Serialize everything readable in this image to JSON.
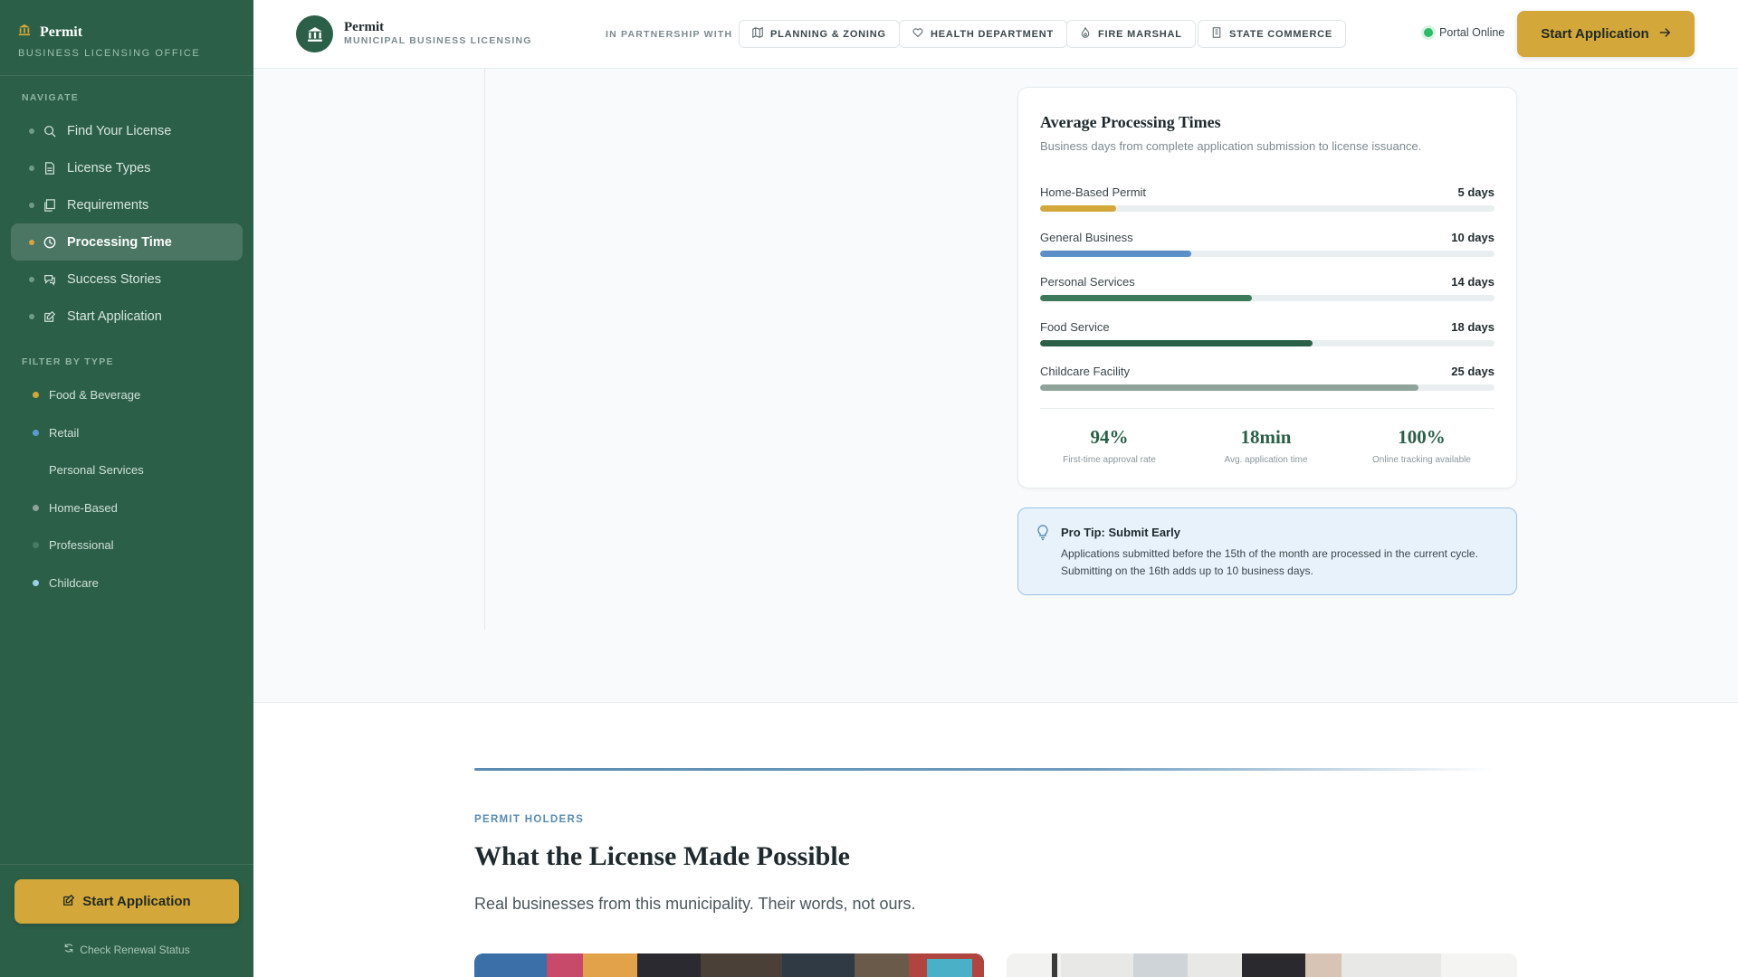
{
  "sidebar": {
    "brand_title": "Permit",
    "brand_sub": "BUSINESS LICENSING OFFICE",
    "nav_label": "NAVIGATE",
    "nav": [
      {
        "label": "Find Your License",
        "icon": "search-icon"
      },
      {
        "label": "License Types",
        "icon": "document-icon"
      },
      {
        "label": "Requirements",
        "icon": "files-icon"
      },
      {
        "label": "Processing Time",
        "icon": "clock-icon",
        "active": true
      },
      {
        "label": "Success Stories",
        "icon": "chat-icon"
      },
      {
        "label": "Start Application",
        "icon": "edit-icon"
      }
    ],
    "filter_label": "FILTER BY TYPE",
    "filters": [
      {
        "label": "Food & Beverage",
        "color": "#d4a73a"
      },
      {
        "label": "Retail",
        "color": "#5a9bd4"
      },
      {
        "label": "Personal Services",
        "color": "#2c5f48"
      },
      {
        "label": "Home-Based",
        "color": "#8fa39a"
      },
      {
        "label": "Professional",
        "color": "#4a7a62"
      },
      {
        "label": "Childcare",
        "color": "#9ad0e8"
      }
    ],
    "cta_label": "Start Application",
    "renew_label": "Check Renewal Status"
  },
  "header": {
    "title": "Permit",
    "subtitle": "MUNICIPAL BUSINESS LICENSING",
    "partner_label": "IN PARTNERSHIP WITH",
    "partners": [
      {
        "label": "PLANNING & ZONING",
        "icon": "map-icon"
      },
      {
        "label": "HEALTH DEPARTMENT",
        "icon": "heart-icon"
      },
      {
        "label": "FIRE MARSHAL",
        "icon": "flame-icon"
      },
      {
        "label": "STATE COMMERCE",
        "icon": "building-icon"
      }
    ],
    "status": "Portal Online",
    "cta_label": "Start Application"
  },
  "processing": {
    "title": "Average Processing Times",
    "description": "Business days from complete application submission to license issuance.",
    "bars": [
      {
        "label": "Home-Based Permit",
        "value": "5 days",
        "days": 5,
        "color": "#d4a73a"
      },
      {
        "label": "General Business",
        "value": "10 days",
        "days": 10,
        "color": "#5a8fc8"
      },
      {
        "label": "Personal Services",
        "value": "14 days",
        "days": 14,
        "color": "#3d7a5c"
      },
      {
        "label": "Food Service",
        "value": "18 days",
        "days": 18,
        "color": "#2c5f48"
      },
      {
        "label": "Childcare Facility",
        "value": "25 days",
        "days": 25,
        "color": "#8fa39a"
      }
    ],
    "max_days": 30,
    "stats": [
      {
        "value": "94%",
        "label": "First-time approval rate"
      },
      {
        "value": "18min",
        "label": "Avg. application time"
      },
      {
        "value": "100%",
        "label": "Online tracking available"
      }
    ]
  },
  "tip": {
    "title": "Pro Tip: Submit Early",
    "body": "Applications submitted before the 15th of the month are processed in the current cycle. Submitting on the 16th adds up to 10 business days."
  },
  "stories": {
    "eyebrow": "PERMIT HOLDERS",
    "title": "What the License Made Possible",
    "lead": "Real businesses from this municipality. Their words, not ours."
  }
}
